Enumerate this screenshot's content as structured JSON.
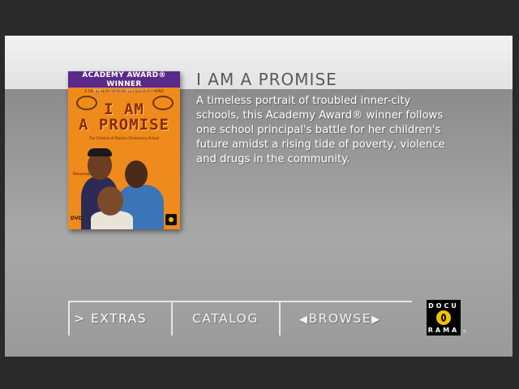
{
  "poster": {
    "award_label": "ACADEMY AWARD® WINNER",
    "award_sub": "BEST DOCUMENTARY FEATURE",
    "credit": "A Film by ALAN RAYMOND and SUSAN RAYMOND",
    "title_line1": "I AM",
    "title_line2": "A PROMISE",
    "tagline": "The Children of Stanton Elementary School",
    "quote": "Remarkable",
    "dvd_mark": "DVD",
    "colors": {
      "background": "#ef8a1c",
      "banner": "#5a2a8a",
      "title": "#8a2a00"
    }
  },
  "feature": {
    "title": "I AM A PROMISE",
    "description": "A timeless portrait of troubled inner-city schools, this Academy Award® winner follows one school principal's battle for her children's future amidst a rising tide of poverty, violence and drugs in the community."
  },
  "menu": {
    "extras": {
      "marker": ">",
      "label": "EXTRAS"
    },
    "catalog": {
      "label": "CATALOG"
    },
    "browse": {
      "prev_glyph": "◀",
      "label": "BROWSE",
      "next_glyph": "▶"
    }
  },
  "logo": {
    "top_text": "DOCU",
    "bottom_text": "RAMA",
    "registered": "®",
    "colors": {
      "background": "#000000",
      "circle": "#f2c200"
    }
  }
}
